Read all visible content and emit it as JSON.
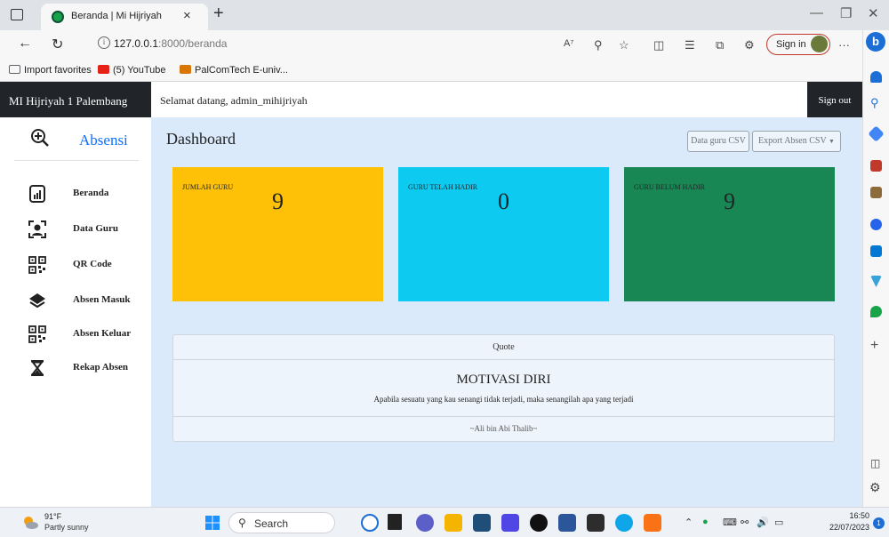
{
  "browser": {
    "tab_title": "Beranda | Mi Hijriyah",
    "tab_close": "×",
    "new_tab": "+",
    "url_host": "127.0.0.1",
    "url_rest": ":8000/beranda",
    "signin_label": "Sign in",
    "more_label": "···",
    "favorites": [
      {
        "label": "Import favorites",
        "color": "#5f6368"
      },
      {
        "label": "(5) YouTube",
        "color": "#e62117"
      },
      {
        "label": "PalComTech E-univ...",
        "color": "#d97706"
      }
    ]
  },
  "app": {
    "brand": "MI Hijriyah 1 Palembang",
    "welcome": "Selamat datang, admin_mihijriyah",
    "signout": "Sign out",
    "sidebar_title": "Absensi",
    "nav": [
      {
        "label": "Beranda",
        "icon": "dashboard-icon"
      },
      {
        "label": "Data Guru",
        "icon": "user-icon"
      },
      {
        "label": "QR Code",
        "icon": "qr-code-icon"
      },
      {
        "label": "Absen Masuk",
        "icon": "layers-icon"
      },
      {
        "label": "Absen Keluar",
        "icon": "qr-code-icon"
      },
      {
        "label": "Rekap Absen",
        "icon": "hourglass-icon"
      }
    ]
  },
  "dashboard": {
    "title": "Dashboard",
    "btn_csv": "Data guru CSV",
    "btn_export": "Export Absen CSV",
    "cards": [
      {
        "label": "JUMLAH GURU",
        "value": "9",
        "bg": "#ffc107",
        "fg": "#212529"
      },
      {
        "label": "GURU TELAH HADIR",
        "value": "0",
        "bg": "#0dcaf0",
        "fg": "#212529"
      },
      {
        "label": "GURU BELUM HADIR",
        "value": "9",
        "bg": "#198754",
        "fg": "#212529"
      }
    ],
    "quote": {
      "header": "Quote",
      "title": "MOTIVASI DIRI",
      "text": "Apabila sesuatu yang kau senangi tidak terjadi, maka senangilah apa yang terjadi",
      "author": "~Ali bin Abi Thalib~"
    }
  },
  "taskbar": {
    "weather_temp": "91°F",
    "weather_desc": "Partly sunny",
    "search_label": "Search",
    "time": "16:50",
    "date": "22/07/2023",
    "notif_count": "1"
  }
}
